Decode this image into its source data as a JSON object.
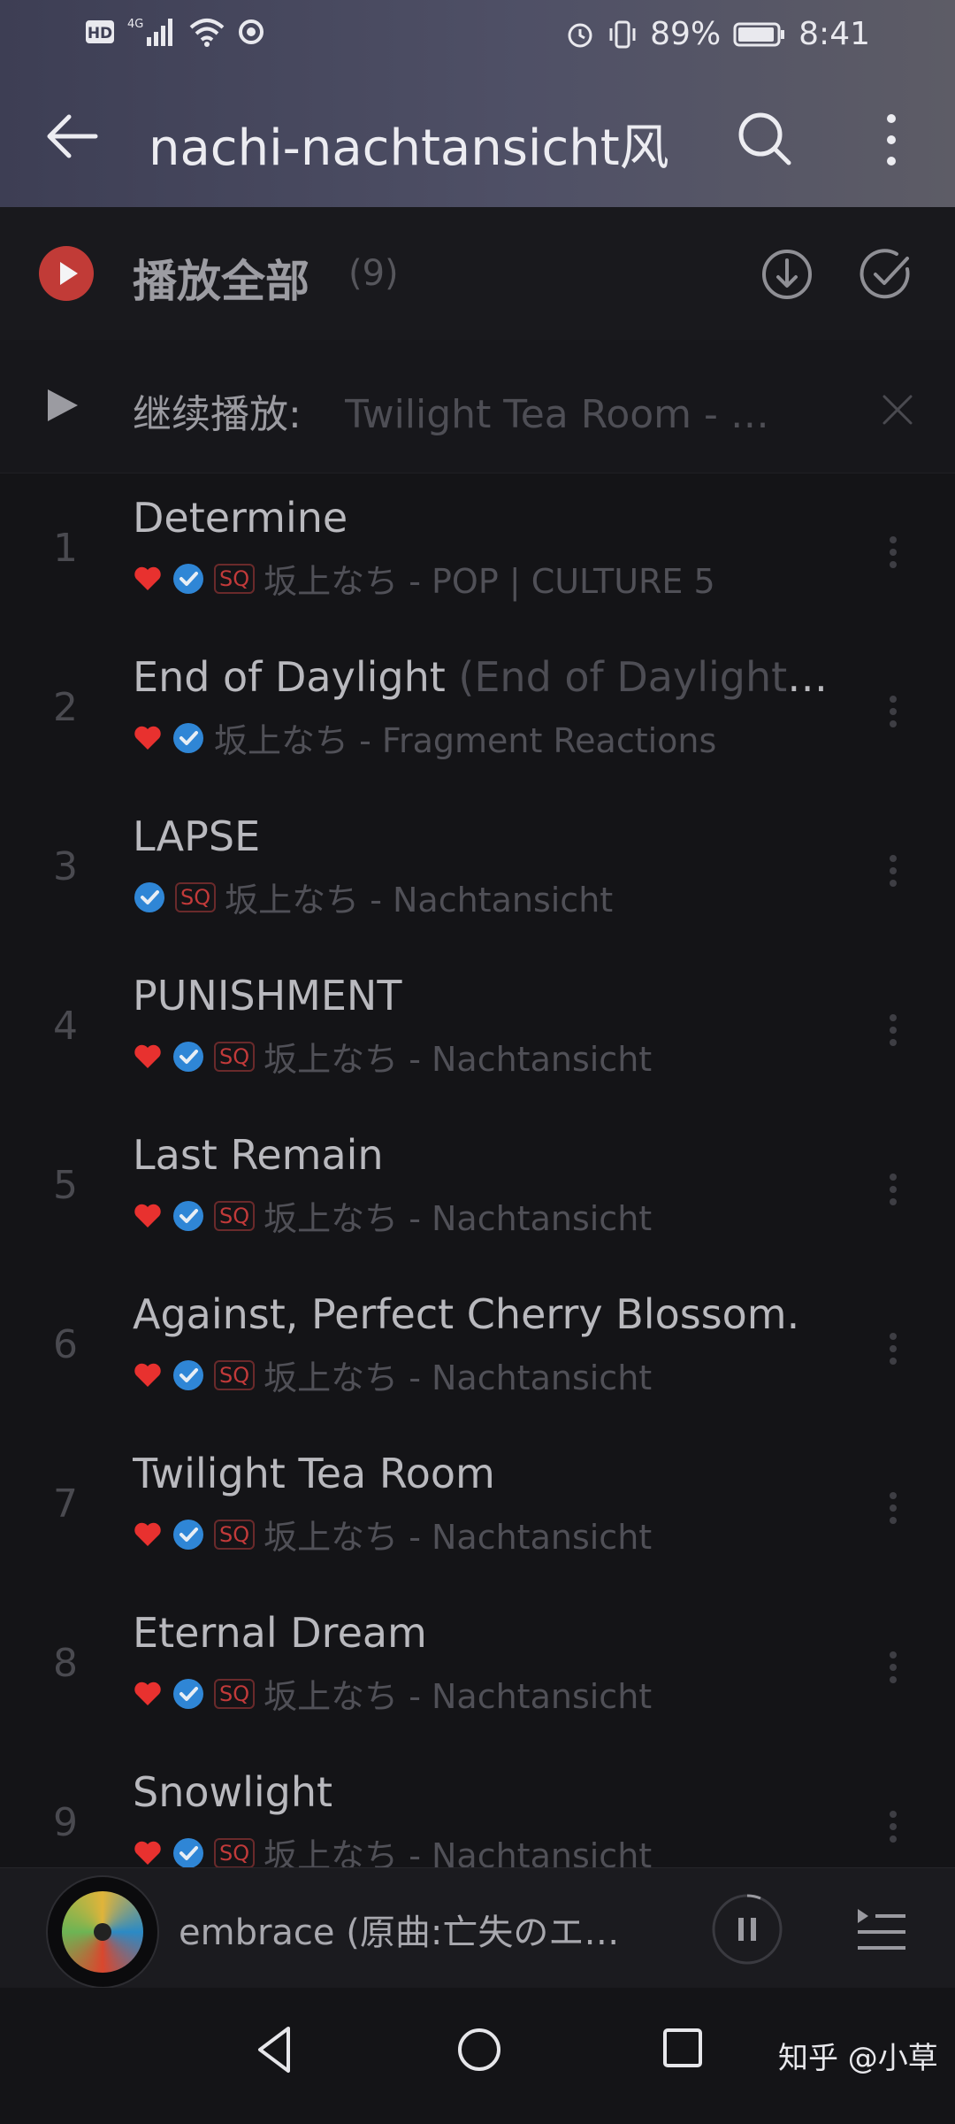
{
  "status_bar": {
    "network_hd": "HD",
    "network_type": "4G",
    "battery_percent": "89%",
    "time": "8:41",
    "icons": [
      "hd-icon",
      "signal-icon",
      "wifi-icon",
      "hotspot-icon",
      "alarm-icon",
      "vibrate-icon",
      "battery-icon"
    ]
  },
  "header": {
    "title": "nachi-nachtansicht风",
    "icons": [
      "back-arrow-icon",
      "search-icon",
      "more-vertical-icon"
    ],
    "background_colors": [
      "#3d3e54",
      "#5d5c66"
    ]
  },
  "play_all": {
    "label": "播放全部",
    "count": "(9)",
    "accent_color": "#c13b37",
    "icons": [
      "play-icon",
      "download-icon",
      "multi-select-icon"
    ]
  },
  "continue_play": {
    "label": "继续播放:",
    "track": "Twilight Tea Room - 坂上なち",
    "icons": [
      "play-icon",
      "close-icon"
    ]
  },
  "songs": [
    {
      "num": "1",
      "title": "Determine",
      "subtitle": "",
      "liked": true,
      "verified": true,
      "sq": true,
      "meta": "坂上なち - POP | CULTURE 5"
    },
    {
      "num": "2",
      "title": "End of Daylight",
      "subtitle": " (End of Daylight feat. Nachi)",
      "liked": true,
      "verified": true,
      "sq": false,
      "meta": "坂上なち - Fragment Reactions"
    },
    {
      "num": "3",
      "title": "LAPSE",
      "subtitle": "",
      "liked": false,
      "verified": true,
      "sq": true,
      "meta": "坂上なち - Nachtansicht"
    },
    {
      "num": "4",
      "title": "PUNISHMENT",
      "subtitle": "",
      "liked": true,
      "verified": true,
      "sq": true,
      "meta": "坂上なち - Nachtansicht"
    },
    {
      "num": "5",
      "title": "Last Remain",
      "subtitle": "",
      "liked": true,
      "verified": true,
      "sq": true,
      "meta": "坂上なち - Nachtansicht"
    },
    {
      "num": "6",
      "title": "Against, Perfect Cherry Blossom.",
      "subtitle": "",
      "liked": true,
      "verified": true,
      "sq": true,
      "meta": "坂上なち - Nachtansicht"
    },
    {
      "num": "7",
      "title": "Twilight Tea Room",
      "subtitle": "",
      "liked": true,
      "verified": true,
      "sq": true,
      "meta": "坂上なち - Nachtansicht"
    },
    {
      "num": "8",
      "title": "Eternal Dream",
      "subtitle": "",
      "liked": true,
      "verified": true,
      "sq": true,
      "meta": "坂上なち - Nachtansicht"
    },
    {
      "num": "9",
      "title": "Snowlight",
      "subtitle": "",
      "liked": true,
      "verified": true,
      "sq": true,
      "meta": "坂上なち - Nachtansicht"
    }
  ],
  "badges": {
    "sq_label": "SQ",
    "heart_color": "#e8312f",
    "verified_color": "#2f86d6"
  },
  "player": {
    "title": "embrace (原曲:亡失のエモーション)",
    "icons": [
      "album-disc-icon",
      "pause-icon",
      "playlist-icon"
    ]
  },
  "nav": {
    "icons": [
      "nav-back-icon",
      "nav-home-icon",
      "nav-recent-icon"
    ],
    "watermark": "知乎 @小草"
  }
}
